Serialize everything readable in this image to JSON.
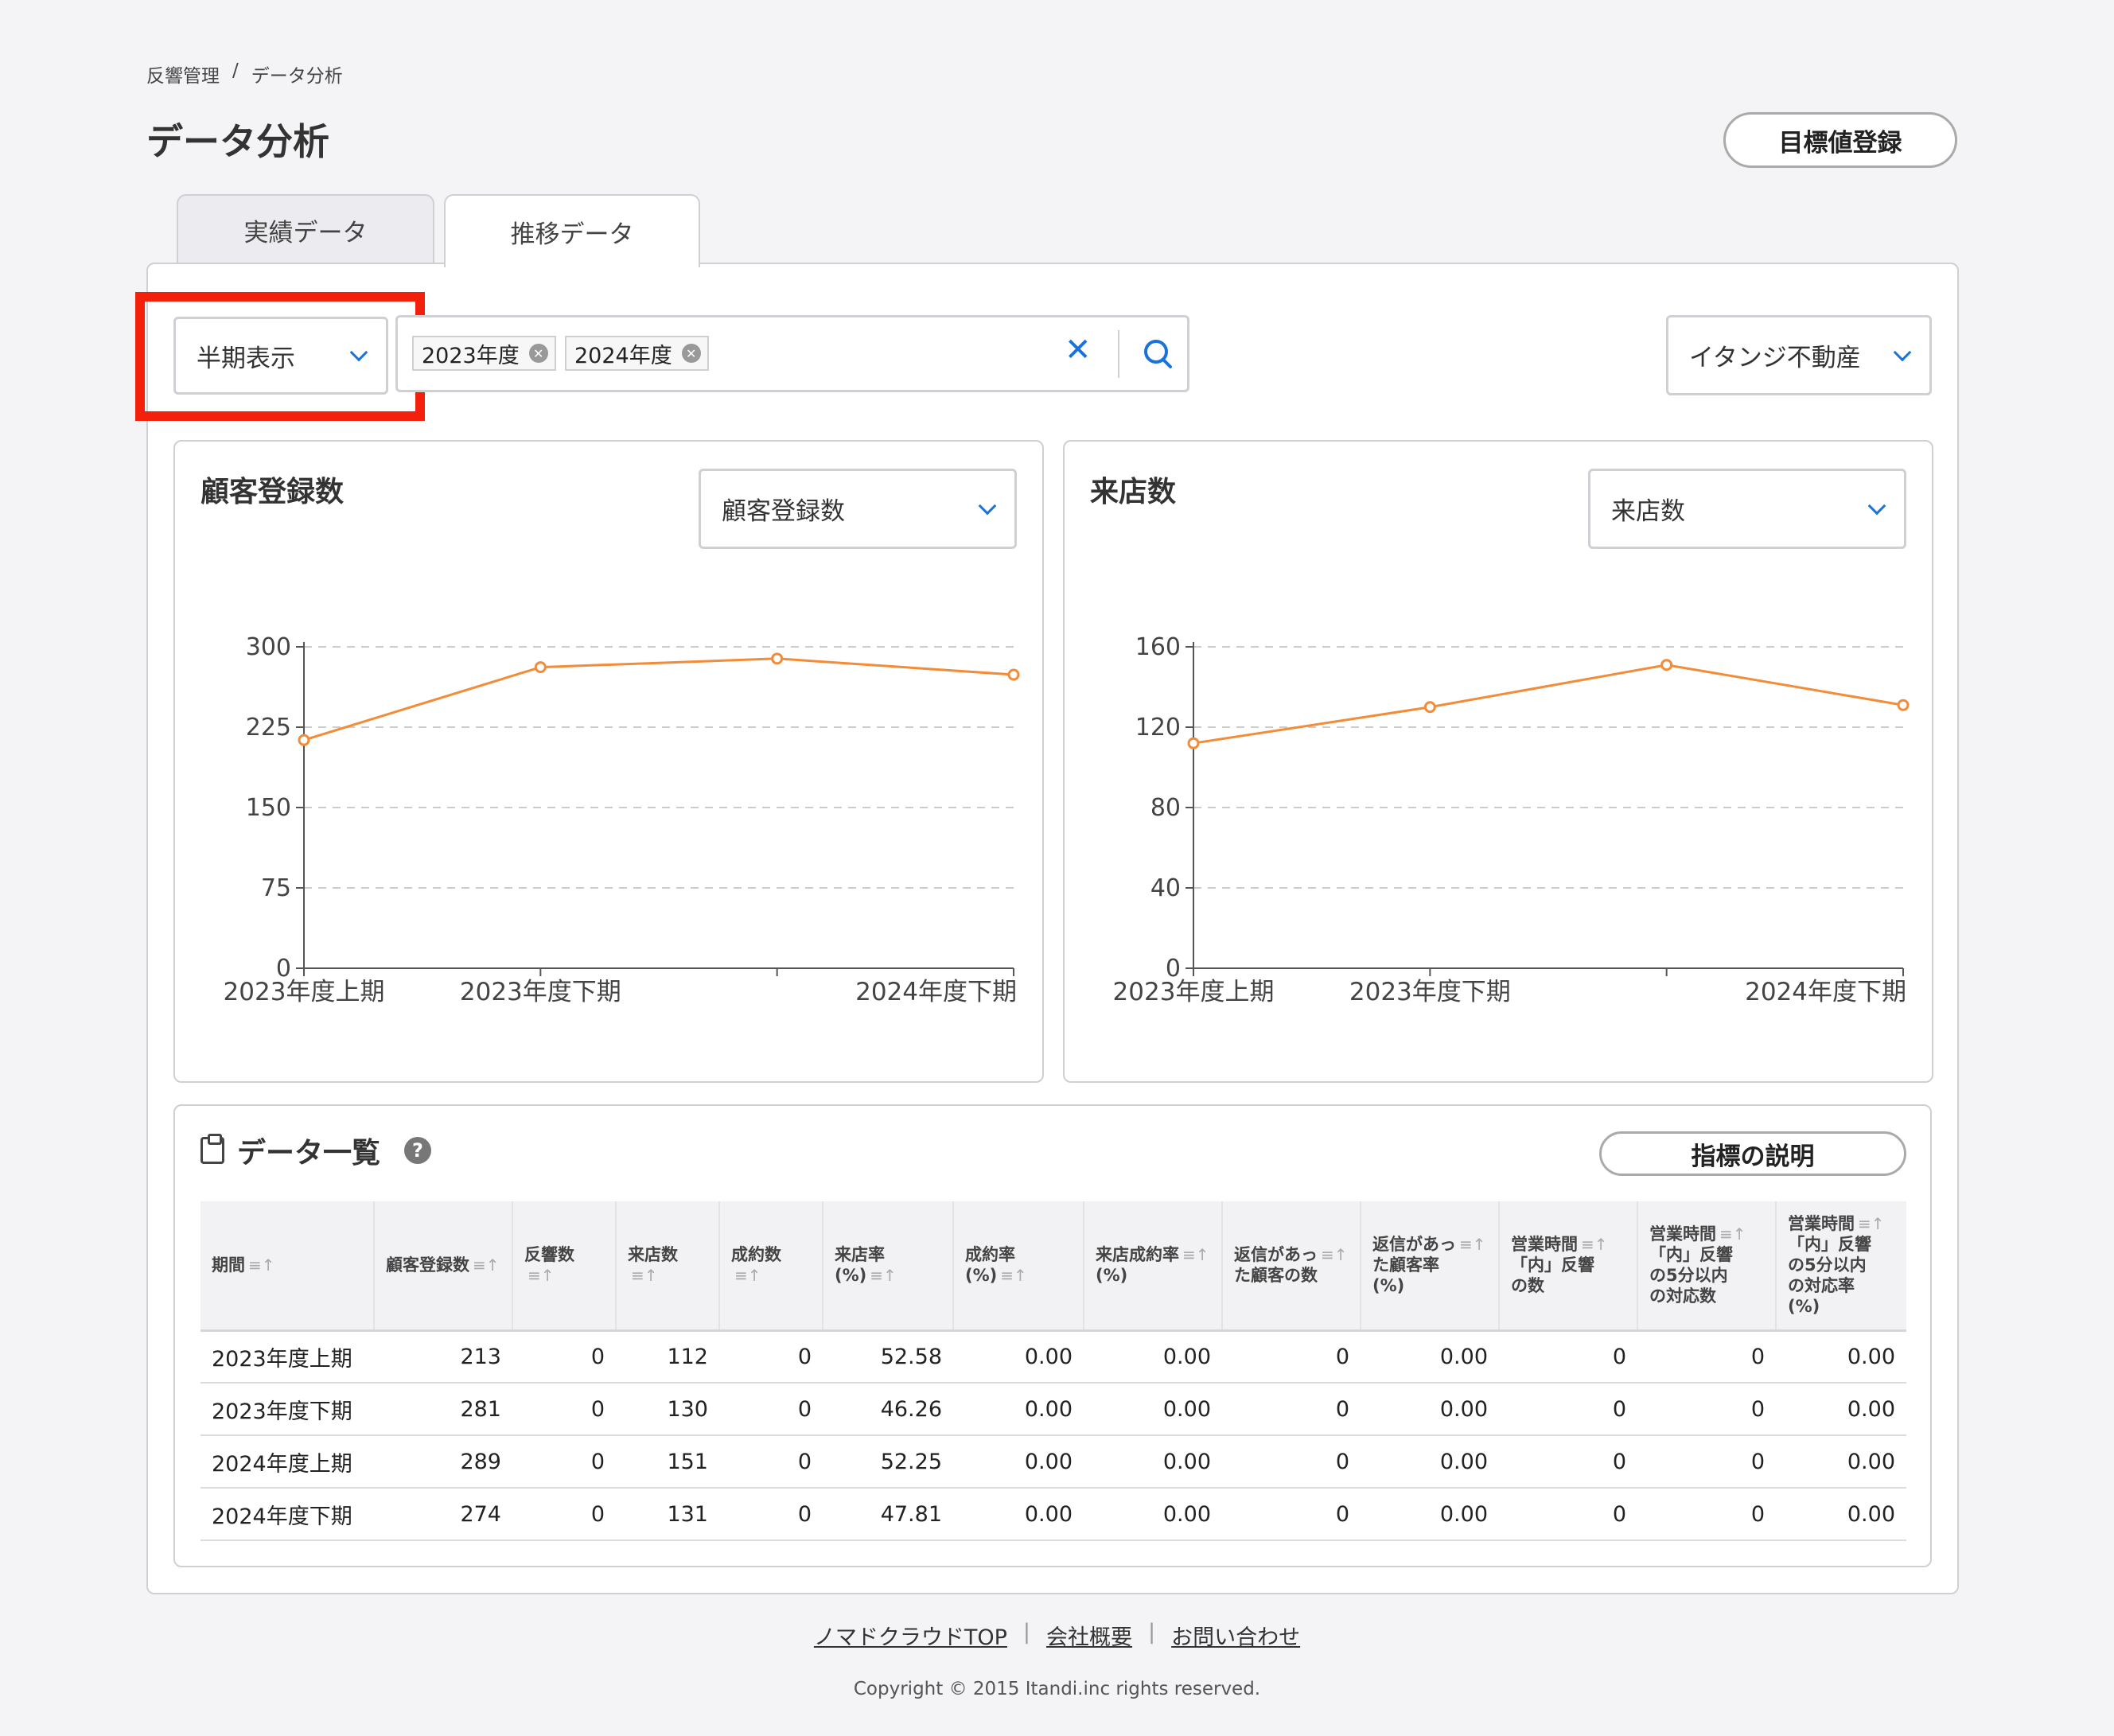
{
  "breadcrumb": [
    "反響管理",
    "/",
    "データ分析"
  ],
  "page_title": "データ分析",
  "target_button": "目標値登録",
  "tabs": [
    {
      "label": "実績データ"
    },
    {
      "label": "推移データ"
    }
  ],
  "period_select": {
    "value": "半期表示"
  },
  "year_filter": {
    "chips": [
      "2023年度",
      "2024年度"
    ]
  },
  "company_select": {
    "value": "イタンジ不動産"
  },
  "charts": [
    {
      "title": "顧客登録数",
      "select": "顧客登録数"
    },
    {
      "title": "来店数",
      "select": "来店数"
    }
  ],
  "chart_data": [
    {
      "type": "line",
      "title": "顧客登録数",
      "categories": [
        "2023年度上期",
        "2023年度下期",
        "2024年度上期",
        "2024年度下期"
      ],
      "x_tick_labels": [
        "2023年度上期",
        "2023年度下期",
        "",
        "2024年度下期"
      ],
      "values": [
        213,
        281,
        289,
        274
      ],
      "ylim": [
        0,
        300
      ],
      "yticks": [
        0,
        75,
        150,
        225,
        300
      ],
      "grid": true,
      "color": "#f28c38"
    },
    {
      "type": "line",
      "title": "来店数",
      "categories": [
        "2023年度上期",
        "2023年度下期",
        "2024年度上期",
        "2024年度下期"
      ],
      "x_tick_labels": [
        "2023年度上期",
        "2023年度下期",
        "",
        "2024年度下期"
      ],
      "values": [
        112,
        130,
        151,
        131
      ],
      "ylim": [
        0,
        160
      ],
      "yticks": [
        0,
        40,
        80,
        120,
        160
      ],
      "grid": true,
      "color": "#f28c38"
    }
  ],
  "table": {
    "title": "データ一覧",
    "explain_button": "指標の説明",
    "sort_icon": "≡↑",
    "headers": [
      [
        "期間"
      ],
      [
        "顧客登録数"
      ],
      [
        "反響数"
      ],
      [
        "来店数"
      ],
      [
        "成約数"
      ],
      [
        "来店率(%)"
      ],
      [
        "成約率(%)"
      ],
      [
        "来店成約率",
        "(%)"
      ],
      [
        "返信があっ",
        "た顧客の数"
      ],
      [
        "返信があっ",
        "た顧客率",
        "(%)"
      ],
      [
        "営業時間",
        "「内」反響",
        "の数"
      ],
      [
        "営業時間",
        "「内」反響",
        "の5分以内",
        "の対応数"
      ],
      [
        "営業時間",
        "「内」反響",
        "の5分以内",
        "の対応率",
        "(%)"
      ]
    ],
    "rows": [
      [
        "2023年度上期",
        "213",
        "0",
        "112",
        "0",
        "52.58",
        "0.00",
        "0.00",
        "0",
        "0.00",
        "0",
        "0",
        "0.00"
      ],
      [
        "2023年度下期",
        "281",
        "0",
        "130",
        "0",
        "46.26",
        "0.00",
        "0.00",
        "0",
        "0.00",
        "0",
        "0",
        "0.00"
      ],
      [
        "2024年度上期",
        "289",
        "0",
        "151",
        "0",
        "52.25",
        "0.00",
        "0.00",
        "0",
        "0.00",
        "0",
        "0",
        "0.00"
      ],
      [
        "2024年度下期",
        "274",
        "0",
        "131",
        "0",
        "47.81",
        "0.00",
        "0.00",
        "0",
        "0.00",
        "0",
        "0",
        "0.00"
      ]
    ]
  },
  "footer": {
    "links": [
      "ノマドクラウドTOP",
      "会社概要",
      "お問い合わせ"
    ],
    "copyright": "Copyright © 2015 Itandi.inc rights reserved."
  },
  "colors": {
    "accent": "#1a73d9",
    "highlight": "#f3200c",
    "line": "#f28c38"
  }
}
